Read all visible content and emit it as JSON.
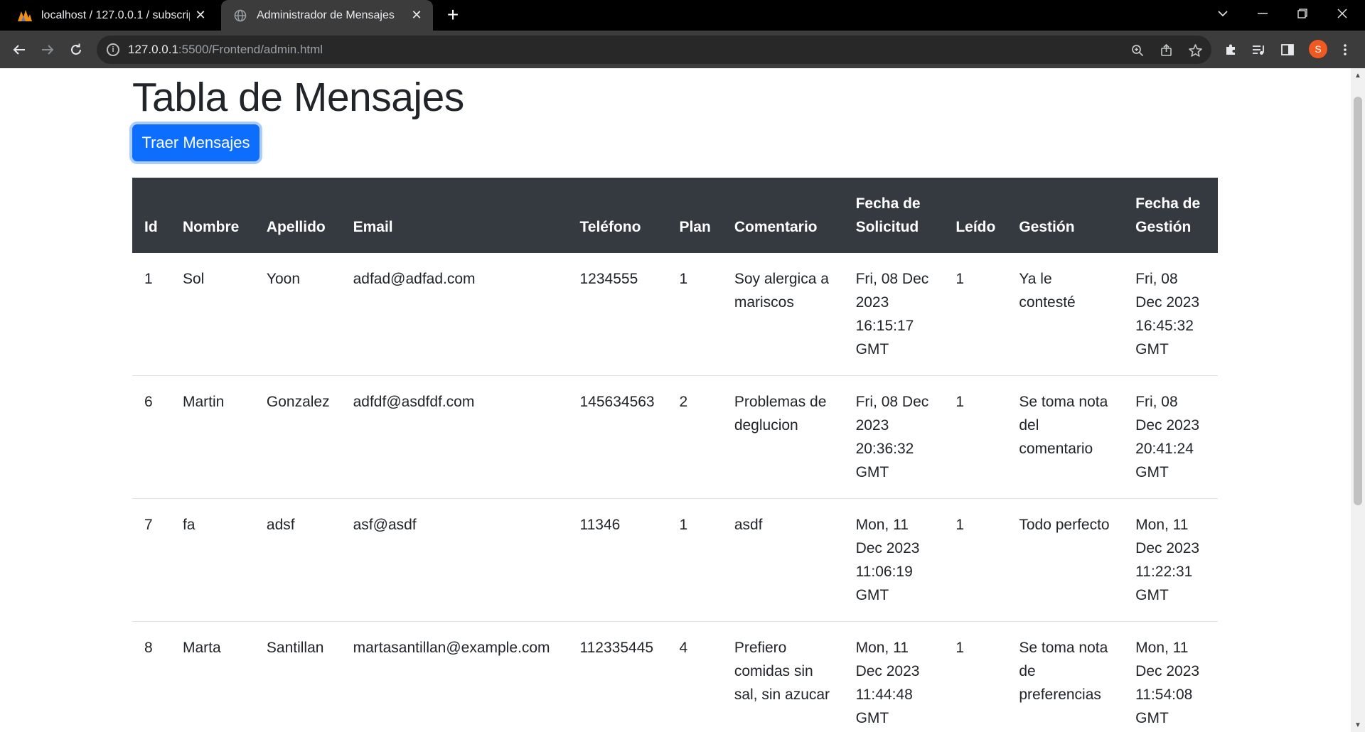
{
  "browser": {
    "tabs": [
      {
        "title": "localhost / 127.0.0.1 / subscripciones",
        "close": "✕"
      },
      {
        "title": "Administrador de Mensajes",
        "close": "✕"
      }
    ],
    "new_tab": "+",
    "url_host": "127.0.0.1",
    "url_path": ":5500/Frontend/admin.html",
    "profile_initial": "S"
  },
  "page": {
    "title": "Tabla de Mensajes",
    "fetch_button": "Traer Mensajes"
  },
  "table": {
    "headers": {
      "id": "Id",
      "nombre": "Nombre",
      "apellido": "Apellido",
      "email": "Email",
      "telefono": "Teléfono",
      "plan": "Plan",
      "comentario": "Comentario",
      "fecha_solicitud": "Fecha de Solicitud",
      "leido": "Leído",
      "gestion": "Gestión",
      "fecha_gestion": "Fecha de Gestión"
    },
    "rows": [
      {
        "id": "1",
        "nombre": "Sol",
        "apellido": "Yoon",
        "email": "adfad@adfad.com",
        "telefono": "1234555",
        "plan": "1",
        "comentario": "Soy alergica a mariscos",
        "fecha_solicitud": "Fri, 08 Dec 2023 16:15:17 GMT",
        "leido": "1",
        "gestion": "Ya le contesté",
        "fecha_gestion": "Fri, 08 Dec 2023 16:45:32 GMT"
      },
      {
        "id": "6",
        "nombre": "Martin",
        "apellido": "Gonzalez",
        "email": "adfdf@asdfdf.com",
        "telefono": "145634563",
        "plan": "2",
        "comentario": "Problemas de deglucion",
        "fecha_solicitud": "Fri, 08 Dec 2023 20:36:32 GMT",
        "leido": "1",
        "gestion": "Se toma nota del comentario",
        "fecha_gestion": "Fri, 08 Dec 2023 20:41:24 GMT"
      },
      {
        "id": "7",
        "nombre": "fa",
        "apellido": "adsf",
        "email": "asf@asdf",
        "telefono": "11346",
        "plan": "1",
        "comentario": "asdf",
        "fecha_solicitud": "Mon, 11 Dec 2023 11:06:19 GMT",
        "leido": "1",
        "gestion": "Todo perfecto",
        "fecha_gestion": "Mon, 11 Dec 2023 11:22:31 GMT"
      },
      {
        "id": "8",
        "nombre": "Marta",
        "apellido": "Santillan",
        "email": "martasantillan@example.com",
        "telefono": "112335445",
        "plan": "4",
        "comentario": "Prefiero comidas sin sal, sin azucar",
        "fecha_solicitud": "Mon, 11 Dec 2023 11:44:48 GMT",
        "leido": "1",
        "gestion": "Se toma nota de preferencias",
        "fecha_gestion": "Mon, 11 Dec 2023 11:54:08 GMT"
      }
    ]
  }
}
